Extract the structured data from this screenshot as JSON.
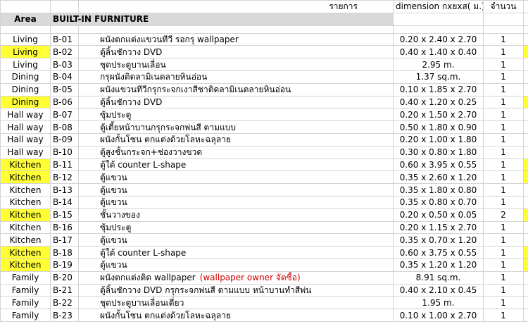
{
  "header": {
    "col_desc": "รายการ",
    "col_dim": "dimension กxยxส( ม.)",
    "col_qty": "จำนวน"
  },
  "title": {
    "area_label": "Area",
    "section": "BUILT-IN  FURNITURE"
  },
  "highlight_color": "#ffff33",
  "note_color": "#cc0000",
  "rows": [
    {
      "area": "Living",
      "code": "B-01",
      "desc": "ผนังตกแต่งแขวนทีวี   รอกรุ   wallpaper",
      "note": "",
      "dim": "0.20 x 2.40 x 2.70",
      "qty": "1",
      "hl": false,
      "hl_right": false
    },
    {
      "area": "Living",
      "code": "B-02",
      "desc": "ตู้ลิ้นชักวาง   DVD",
      "note": "",
      "dim": "0.40 x 1.40 x 0.40",
      "qty": "1",
      "hl": true,
      "hl_right": true
    },
    {
      "area": "Living",
      "code": "B-03",
      "desc": "ชุดประตูบานเลื่อน",
      "note": "",
      "dim": "2.95 m.",
      "qty": "1",
      "hl": false,
      "hl_right": false
    },
    {
      "area": "Dining",
      "code": "B-04",
      "desc": "กรุผนังติดลามิเนตลายหินอ่อน",
      "note": "",
      "dim": "1.37 sq.m.",
      "qty": "1",
      "hl": false,
      "hl_right": false
    },
    {
      "area": "Dining",
      "code": "B-05",
      "desc": "ผนังแขวนทีวีกรุกระจกเงาสีชาติดลามิเนตลายหินอ่อน",
      "note": "",
      "dim": "0.10 x 1.85 x 2.70",
      "qty": "1",
      "hl": false,
      "hl_right": false
    },
    {
      "area": "Dining",
      "code": "B-06",
      "desc": "ตู้ลิ้นชักวาง   DVD",
      "note": "",
      "dim": "0.40 x 1.20 x 0.25",
      "qty": "1",
      "hl": true,
      "hl_right": true
    },
    {
      "area": "Hall way",
      "code": "B-07",
      "desc": "ซุ้มประตู",
      "note": "",
      "dim": "0.20 x 1.50 x 2.70",
      "qty": "1",
      "hl": false,
      "hl_right": false
    },
    {
      "area": "Hall way",
      "code": "B-08",
      "desc": "ตู้เตี้ยหน้าบานกรุกระจกพ่นสี   ตามแบบ",
      "note": "",
      "dim": "0.50 x 1.80 x 0.90",
      "qty": "1",
      "hl": false,
      "hl_right": false
    },
    {
      "area": "Hall way",
      "code": "B-09",
      "desc": "ผนังกั้นโซน   ตกแต่งด้วยโลหะฉลุลาย",
      "note": "",
      "dim": "0.20 x 1.00 x 1.80",
      "qty": "1",
      "hl": false,
      "hl_right": false
    },
    {
      "area": "Hall way",
      "code": "B-10",
      "desc": "ตู้สูงชั้นกระจก+ช่องวางขวด",
      "note": "",
      "dim": "0.30 x 0.80 x 1.80",
      "qty": "1",
      "hl": false,
      "hl_right": false
    },
    {
      "area": "Kitchen",
      "code": "B-11",
      "desc": "ตู้ใต้   counter L-shape",
      "note": "",
      "dim": "0.60 x 3.95 x 0.55",
      "qty": "1",
      "hl": true,
      "hl_right": true
    },
    {
      "area": "Kitchen",
      "code": "B-12",
      "desc": "ตู้แขวน",
      "note": "",
      "dim": "0.35 x 2.60 x 1.20",
      "qty": "1",
      "hl": true,
      "hl_right": true
    },
    {
      "area": "Kitchen",
      "code": "B-13",
      "desc": "ตู้แขวน",
      "note": "",
      "dim": "0.35 x 1.80 x 0.80",
      "qty": "1",
      "hl": false,
      "hl_right": false
    },
    {
      "area": "Kitchen",
      "code": "B-14",
      "desc": "ตู้แขวน",
      "note": "",
      "dim": "0.35 x 0.80 x 0.70",
      "qty": "1",
      "hl": false,
      "hl_right": false
    },
    {
      "area": "Kitchen",
      "code": "B-15",
      "desc": "ชั้นวางของ",
      "note": "",
      "dim": "0.20 x 0.50 x 0.05",
      "qty": "2",
      "hl": true,
      "hl_right": true
    },
    {
      "area": "Kitchen",
      "code": "B-16",
      "desc": "ซุ้มประตู",
      "note": "",
      "dim": "0.20 x 1.15 x 2.70",
      "qty": "1",
      "hl": false,
      "hl_right": false
    },
    {
      "area": "Kitchen",
      "code": "B-17",
      "desc": "ตู้แขวน",
      "note": "",
      "dim": "0.35 x 0.70 x 1.20",
      "qty": "1",
      "hl": false,
      "hl_right": false
    },
    {
      "area": "Kitchen",
      "code": "B-18",
      "desc": "ตู้ใต้   counter L-shape",
      "note": "",
      "dim": "0.60 x 3.75 x 0.55",
      "qty": "1",
      "hl": true,
      "hl_right": true
    },
    {
      "area": "Kitchen",
      "code": "B-19",
      "desc": "ตู้แขวน",
      "note": "",
      "dim": "0.35 x 1.20 x 1.20",
      "qty": "1",
      "hl": true,
      "hl_right": true
    },
    {
      "area": "Family",
      "code": "B-20",
      "desc": "ผนังตกแต่งติด   wallpaper",
      "note": "(wallpaper  owner จัดซื้อ)",
      "dim": "8.91 sq.m.",
      "qty": "1",
      "hl": false,
      "hl_right": false
    },
    {
      "area": "Family",
      "code": "B-21",
      "desc": "ตู้ลิ้นชักวาง   DVD กรุกระจกพ่นสี   ตามแบบ   หน้าบานทำสีพ่น",
      "note": "",
      "dim": "0.40 x 2.10 x 0.45",
      "qty": "1",
      "hl": false,
      "hl_right": false
    },
    {
      "area": "Family",
      "code": "B-22",
      "desc": "ชุดประตูบานเลื่อนเดี่ยว",
      "note": "",
      "dim": "1.95 m.",
      "qty": "1",
      "hl": false,
      "hl_right": false
    },
    {
      "area": "Family",
      "code": "B-23",
      "desc": "ผนังกั้นโซน   ตกแต่งด้วยโลหะฉลุลาย",
      "note": "",
      "dim": "0.10 x 1.00 x 2.70",
      "qty": "1",
      "hl": false,
      "hl_right": false
    }
  ]
}
